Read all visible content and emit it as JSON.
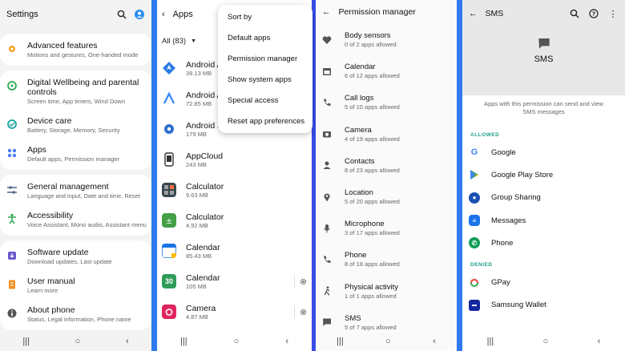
{
  "settings": {
    "title": "Settings",
    "items": [
      {
        "title": "Advanced features",
        "subtitle": "Motions and gestures, One-handed mode",
        "icon": "gear-plus-icon",
        "color": "#f0a020"
      },
      {
        "title": "Digital Wellbeing and parental controls",
        "subtitle": "Screen time, App timers, Wind Down",
        "icon": "wellbeing-icon",
        "color": "#2eaa50"
      },
      {
        "title": "Device care",
        "subtitle": "Battery, Storage, Memory, Security",
        "icon": "device-care-icon",
        "color": "#19a3a0"
      },
      {
        "title": "Apps",
        "subtitle": "Default apps, Permission manager",
        "icon": "apps-icon",
        "color": "#4a7ef0"
      },
      {
        "title": "General management",
        "subtitle": "Language and input, Date and time, Reset",
        "icon": "sliders-icon",
        "color": "#5a6b8a"
      },
      {
        "title": "Accessibility",
        "subtitle": "Voice Assistant, Mono audio, Assistant menu",
        "icon": "accessibility-icon",
        "color": "#2eaa50"
      },
      {
        "title": "Software update",
        "subtitle": "Download updates, Last update",
        "icon": "software-update-icon",
        "color": "#6a5acd"
      },
      {
        "title": "User manual",
        "subtitle": "Learn more",
        "icon": "manual-icon",
        "color": "#f09020"
      },
      {
        "title": "About phone",
        "subtitle": "Status, Legal information, Phone name",
        "icon": "info-icon",
        "color": "#555555"
      }
    ]
  },
  "apps": {
    "title": "Apps",
    "filter": "All (83)",
    "items": [
      {
        "name": "Android A",
        "size": "39.13 MB",
        "icon": "android-auto-icon",
        "color": "#2a7be4"
      },
      {
        "name": "Android A",
        "size": "72.85 MB",
        "icon": "android-accessibility-icon",
        "color": "#3d8bfd"
      },
      {
        "name": "Android System WebView",
        "size": "179 MB",
        "icon": "webview-gear-icon",
        "color": "#2d6fd0"
      },
      {
        "name": "AppCloud",
        "size": "243 MB",
        "icon": "appcloud-icon",
        "color": "#333333"
      },
      {
        "name": "Calculator",
        "size": "9.63 MB",
        "icon": "calculator-icon",
        "color": "#37474f"
      },
      {
        "name": "Calculator",
        "size": "4.92 MB",
        "icon": "calculator-green-icon",
        "color": "#43a047"
      },
      {
        "name": "Calendar",
        "size": "85.43 MB",
        "icon": "calendar-icon",
        "color": "#1a73e8"
      },
      {
        "name": "Calendar",
        "size": "105 MB",
        "icon": "calendar-30-icon",
        "color": "#2e9d5a",
        "has_gear": true,
        "icon_text": "30"
      },
      {
        "name": "Camera",
        "size": "4.87 MB",
        "icon": "camera-icon",
        "color": "#e0245e",
        "has_gear": true
      }
    ],
    "menu": [
      "Sort by",
      "Default apps",
      "Permission manager",
      "Show system apps",
      "Special access",
      "Reset app preferences"
    ]
  },
  "permissions": {
    "title": "Permission manager",
    "items": [
      {
        "name": "Body sensors",
        "count": "0 of 2 apps allowed",
        "icon": "heart-pulse-icon"
      },
      {
        "name": "Calendar",
        "count": "6 of 12 apps allowed",
        "icon": "calendar-icon"
      },
      {
        "name": "Call logs",
        "count": "5 of 10 apps allowed",
        "icon": "call-log-icon"
      },
      {
        "name": "Camera",
        "count": "4 of 19 apps allowed",
        "icon": "camera-icon"
      },
      {
        "name": "Contacts",
        "count": "8 of 23 apps allowed",
        "icon": "person-icon"
      },
      {
        "name": "Location",
        "count": "5 of 20 apps allowed",
        "icon": "location-pin-icon"
      },
      {
        "name": "Microphone",
        "count": "3 of 17 apps allowed",
        "icon": "microphone-icon"
      },
      {
        "name": "Phone",
        "count": "8 of 18 apps allowed",
        "icon": "phone-icon"
      },
      {
        "name": "Physical activity",
        "count": "1 of 1 apps allowed",
        "icon": "walking-icon"
      },
      {
        "name": "SMS",
        "count": "5 of 7 apps allowed",
        "icon": "sms-icon"
      }
    ]
  },
  "sms": {
    "title": "SMS",
    "hero_title": "SMS",
    "description": "Apps with this permission can send and view SMS messages",
    "allowed_label": "ALLOWED",
    "denied_label": "DENIED",
    "allowed": [
      {
        "name": "Google",
        "icon": "google-icon",
        "color": "#4285f4",
        "letter": "G"
      },
      {
        "name": "Google Play Store",
        "icon": "play-store-icon",
        "color": "#34a853",
        "letter": "▶"
      },
      {
        "name": "Group Sharing",
        "icon": "group-sharing-icon",
        "color": "#1b4fb5",
        "letter": "●"
      },
      {
        "name": "Messages",
        "icon": "messages-icon",
        "color": "#1a73e8",
        "letter": "≡"
      },
      {
        "name": "Phone",
        "icon": "phone-app-icon",
        "color": "#0f9d58",
        "letter": "✆"
      }
    ],
    "denied": [
      {
        "name": "GPay",
        "icon": "gpay-icon",
        "color": "#ea4335",
        "letter": "G"
      },
      {
        "name": "Samsung Wallet",
        "icon": "samsung-wallet-icon",
        "color": "#1428a0",
        "letter": "▬"
      }
    ]
  },
  "navbar": {
    "recents": "|||",
    "home": "○",
    "back": "‹"
  },
  "colors": {
    "accent": "#1e9e8a",
    "brand_blue": "#1a73e8"
  }
}
